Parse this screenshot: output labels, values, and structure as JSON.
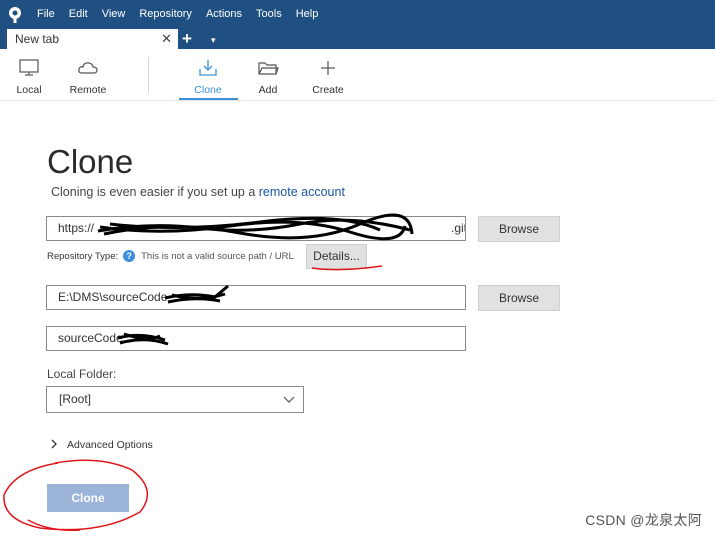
{
  "menubar": {
    "items": [
      "File",
      "Edit",
      "View",
      "Repository",
      "Actions",
      "Tools",
      "Help"
    ],
    "color": "#205081"
  },
  "tabs": {
    "active_label": "New tab",
    "close_glyph": "✕",
    "add_glyph": "+",
    "dropdown_glyph": "▾"
  },
  "toolbar": {
    "local": "Local",
    "remote": "Remote",
    "clone": "Clone",
    "add": "Add",
    "create": "Create",
    "active_color": "#3a8fd9"
  },
  "clone_page": {
    "title": "Clone",
    "subtitle_text": "Cloning is even easier if you set up a ",
    "subtitle_link": "remote account",
    "url_prefix": "https://",
    "url_suffix": ".git",
    "browse_label": "Browse",
    "repo_type_label": "Repository Type:",
    "help_glyph": "?",
    "invalid_message": "This is not a valid source path / URL",
    "details_label": "Details...",
    "dest_path": "E:\\DMS\\sourceCode",
    "browse_label_2": "Browse",
    "name_value": "sourceCode",
    "local_folder_label": "Local Folder:",
    "local_folder_value": "[Root]",
    "advanced_label": "Advanced Options",
    "clone_button": "Clone",
    "clone_button_color": "#9bb4d8"
  },
  "watermark": "CSDN @龙泉太阿",
  "annotation_color": "#e0141c"
}
